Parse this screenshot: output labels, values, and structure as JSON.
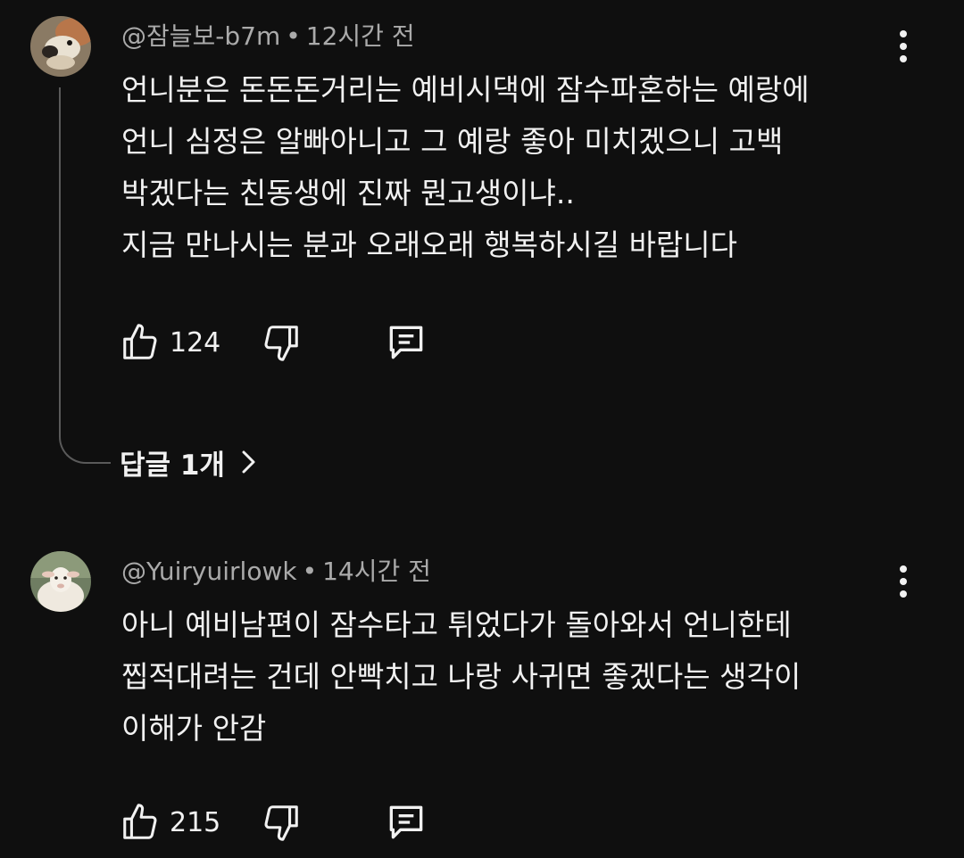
{
  "comments": [
    {
      "author": "@잠늘보-b7m",
      "separator": "•",
      "time": "12시간 전",
      "lines": [
        "언니분은 돈돈돈거리는 예비시댁에 잠수파혼하는 예랑에",
        "언니 심정은 알빠아니고 그 예랑 좋아 미치겠으니 고백",
        "박겠다는 친동생에 진짜 뭔고생이냐..",
        "지금 만나시는 분과 오래오래 행복하시길 바랍니다"
      ],
      "likes": "124",
      "avatar_icon": "dog-photo-avatar",
      "replies_label": "답글 1개"
    },
    {
      "author": "@Yuiryuirlowk",
      "separator": "•",
      "time": "14시간 전",
      "lines": [
        "아니 예비남편이 잠수타고 튀었다가 돌아와서 언니한테",
        "찝적대려는 건데 안빡치고 나랑 사귀면 좋겠다는 생각이",
        "이해가 안감"
      ],
      "likes": "215",
      "avatar_icon": "lamb-photo-avatar"
    }
  ],
  "icons": {
    "like": "thumbs-up-icon",
    "dislike": "thumbs-down-icon",
    "reply": "comment-icon",
    "menu": "more-vert-icon",
    "chevron": "chevron-right-icon"
  },
  "colors": {
    "background": "#0f0f0f",
    "text": "#f1f1f1",
    "secondary_text": "#aaaaaa",
    "thread_line": "#5a5a5a"
  }
}
